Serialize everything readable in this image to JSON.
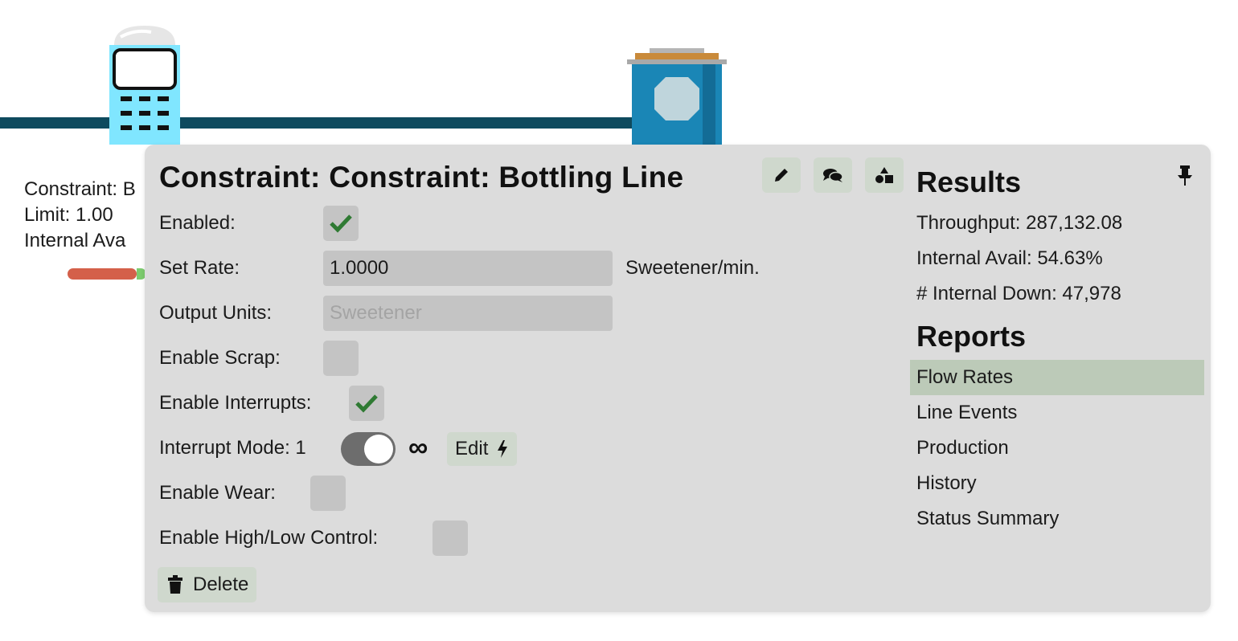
{
  "canvas": {
    "label_lines": [
      "Constraint: B",
      "Limit: 1.00",
      "Internal Ava"
    ]
  },
  "panel": {
    "title": "Constraint: Constraint: Bottling Line",
    "toolbar": {
      "edit_icon": "pencil-icon",
      "comments_icon": "comments-icon",
      "shapes_icon": "shapes-icon"
    },
    "fields": {
      "enabled_label": "Enabled:",
      "enabled_checked": true,
      "set_rate_label": "Set Rate:",
      "set_rate_value": "1.0000",
      "set_rate_units": "Sweetener/min.",
      "output_units_label": "Output Units:",
      "output_units_placeholder": "Sweetener",
      "enable_scrap_label": "Enable Scrap:",
      "enable_scrap_checked": false,
      "enable_interrupts_label": "Enable Interrupts:",
      "enable_interrupts_checked": true,
      "interrupt_mode_label": "Interrupt Mode: 1",
      "interrupt_mode_infinity": "∞",
      "interrupt_edit_label": "Edit",
      "enable_wear_label": "Enable Wear:",
      "enable_wear_checked": false,
      "enable_highlow_label": "Enable High/Low Control:",
      "enable_highlow_checked": false
    },
    "delete_label": "Delete",
    "results": {
      "heading": "Results",
      "throughput": "Throughput: 287,132.08",
      "internal_avail": "Internal Avail: 54.63%",
      "internal_down": "# Internal Down: 47,978"
    },
    "reports": {
      "heading": "Reports",
      "items": [
        "Flow Rates",
        "Line Events",
        "Production",
        "History",
        "Status Summary"
      ],
      "active_index": 0
    }
  },
  "colors": {
    "line": "#0e4a5e",
    "panel_bg": "#dcdcdc",
    "button_bg": "#cfd8cd",
    "active_report": "#bccab8",
    "check_green": "#2f7a33",
    "node_cyan": "#80e6ff",
    "tank_blue": "#1a86b6"
  }
}
